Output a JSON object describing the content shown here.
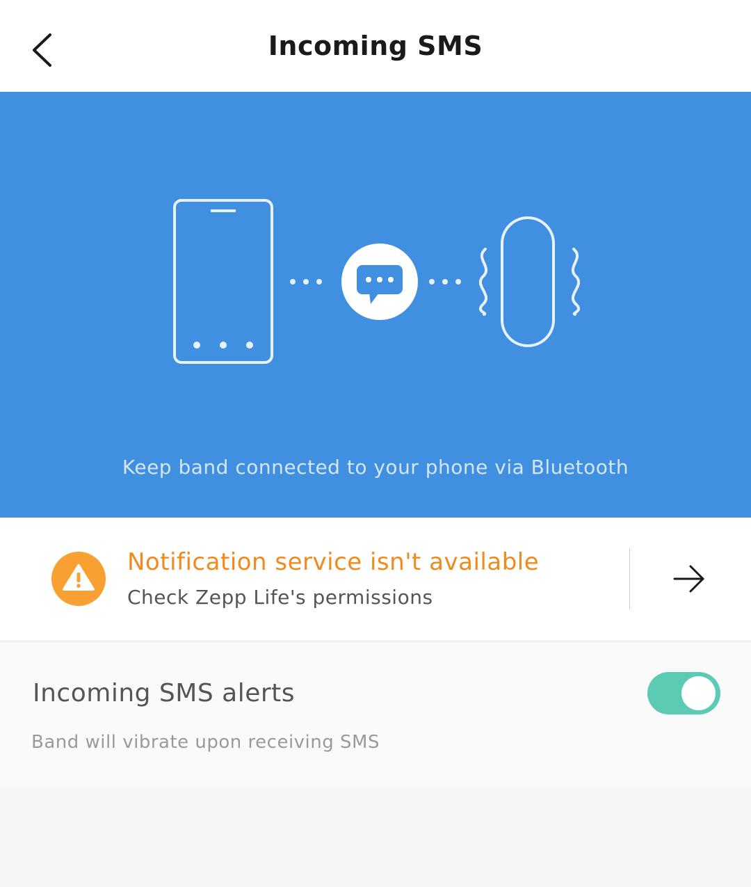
{
  "header": {
    "title": "Incoming SMS",
    "back_icon": "chevron-left-icon"
  },
  "hero": {
    "caption": "Keep band connected to your phone via Bluetooth",
    "background_color": "#418fe0",
    "icons": [
      "phone-icon",
      "message-bubble-icon",
      "band-vibrate-icon"
    ]
  },
  "notice": {
    "title": "Notification service isn't available",
    "subtitle": "Check Zepp Life's permissions",
    "icon": "warning-icon",
    "action_icon": "arrow-right-icon",
    "accent_color": "#f08a1c"
  },
  "setting": {
    "title": "Incoming SMS alerts",
    "description": "Band will vibrate upon receiving SMS",
    "toggle_on": true,
    "toggle_color": "#5dcab3"
  }
}
